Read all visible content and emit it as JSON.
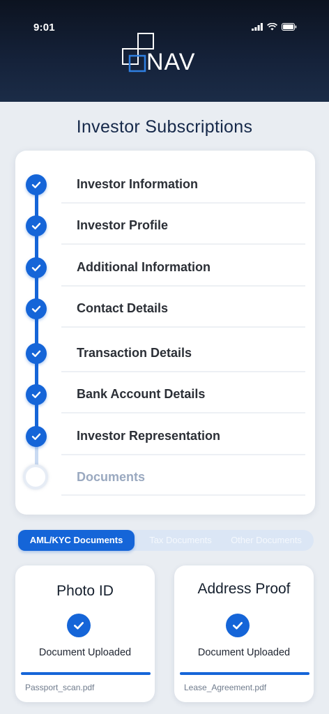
{
  "status_bar": {
    "time": "9:01"
  },
  "brand": {
    "logo_text": "NAV"
  },
  "page": {
    "title": "Investor Subscriptions"
  },
  "steps": [
    {
      "label": "Investor Information",
      "done": true
    },
    {
      "label": "Investor Profile",
      "done": true
    },
    {
      "label": "Additional Information",
      "done": true
    },
    {
      "label": "Contact Details",
      "done": true
    },
    {
      "label": "Transaction Details",
      "done": true
    },
    {
      "label": "Bank Account Details",
      "done": true
    },
    {
      "label": "Investor Representation",
      "done": true
    },
    {
      "label": "Documents",
      "done": false
    }
  ],
  "tabs": [
    {
      "label": "AML/KYC Documents",
      "active": true
    },
    {
      "label": "Tax Documents",
      "active": false
    },
    {
      "label": "Other Documents",
      "active": false
    }
  ],
  "documents": [
    {
      "title": "Photo ID",
      "status": "Document Uploaded",
      "file": "Passport_scan.pdf",
      "progress": 1.0
    },
    {
      "title": "Address Proof",
      "status": "Document Uploaded",
      "file": "Lease_Agreement.pdf",
      "progress": 1.0
    }
  ],
  "colors": {
    "accent": "#1565d8",
    "header_bg": "#131e33",
    "page_bg": "#e9edf2",
    "pending": "#9aa9c0"
  }
}
